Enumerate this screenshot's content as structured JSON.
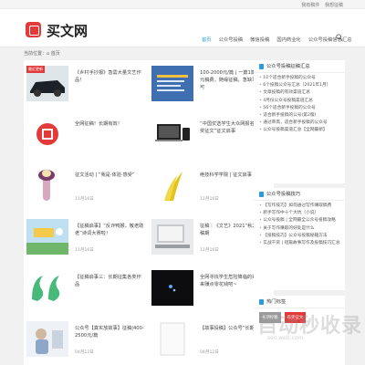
{
  "topbar": {
    "links": [
      "我有稿件",
      "我想征稿"
    ]
  },
  "header": {
    "logo_text": "买文网",
    "nav": [
      "首页",
      "公众号投稿",
      "微信投稿",
      "国内商业化",
      "公众号投稿信息汇总"
    ]
  },
  "breadcrumb": "当前位置：⌂ 首页",
  "articles": [
    {
      "title": "《乡村手抄报》急需大量文艺作品！",
      "date": "",
      "badge": "最近更新"
    },
    {
      "title": "100-2000元/篇 | 一篇1篇了500元稿费，随缘征稿，急缺写手，可",
      "date": ""
    },
    {
      "title": "全网征稿！长期有效！",
      "date": ""
    },
    {
      "title": "“中国优选学生大众网报名征稿有奖征文”征文启事",
      "date": ""
    },
    {
      "title": "征文活动 | “我是·体验·感受”",
      "date": "11月16日"
    },
    {
      "title": "绝技科学学院 | 征文启事",
      "date": "11月16日"
    },
    {
      "title": "【征稿启事】“反诈鸭猴，敬老助老”诗词大赛啦！",
      "date": "11月16日"
    },
    {
      "title": "征稿｜《文艺》2021“秋之都”征稿期",
      "date": "11月16日"
    },
    {
      "title": "【征稿启事三：长期征集各类作品",
      "date": ""
    },
    {
      "title": "全网寻找学生危险降临的兼职，来赚点零花钱吧~",
      "date": ""
    },
    {
      "title": "公众号【真实放故事】征稿|400-2500元/篇",
      "date": "04月12日"
    },
    {
      "title": "【故事投稿】公众号“长期投稿”",
      "date": "04月12日"
    }
  ],
  "sidebar": {
    "box1": {
      "heading": "公众号投稿征稿汇总",
      "items": [
        "10个适合新手投稿的公众号",
        "6个投稿公众号汇总（2021年1月）",
        "文章投稿的有效渠道汇总",
        "4月份公众号投稿渠道汇总",
        "56个适合新手投稿的公众号",
        "适合新手投稿的公号(第2版)",
        "通过审高，适合新手投稿的公众号",
        "公众号投稿渠道汇总【全网最新】"
      ]
    },
    "box2": {
      "heading": "公众号投稿技巧",
      "items": [
        "【写作技巧】如何通过写作赚取稿费",
        "新手写作中十个大坑（小说）",
        "公众号投稿 | 全网最全公众号投稿攻略",
        "关于写作赚取的好处是什么",
        "【投稿技巧】公众号投稿秘籍方法",
        "实战干货 | 短篇故事写作及投稿技巧汇总"
      ]
    },
    "box3": {
      "heading": "热门标签",
      "tags": [
        {
          "label": "长期投稿",
          "color": "#9a9a9a"
        },
        {
          "label": "有奖征文",
          "color": "#e23a3a"
        }
      ]
    }
  },
  "watermark": {
    "text": "自动秒收录",
    "sub": "seo.web.com"
  }
}
